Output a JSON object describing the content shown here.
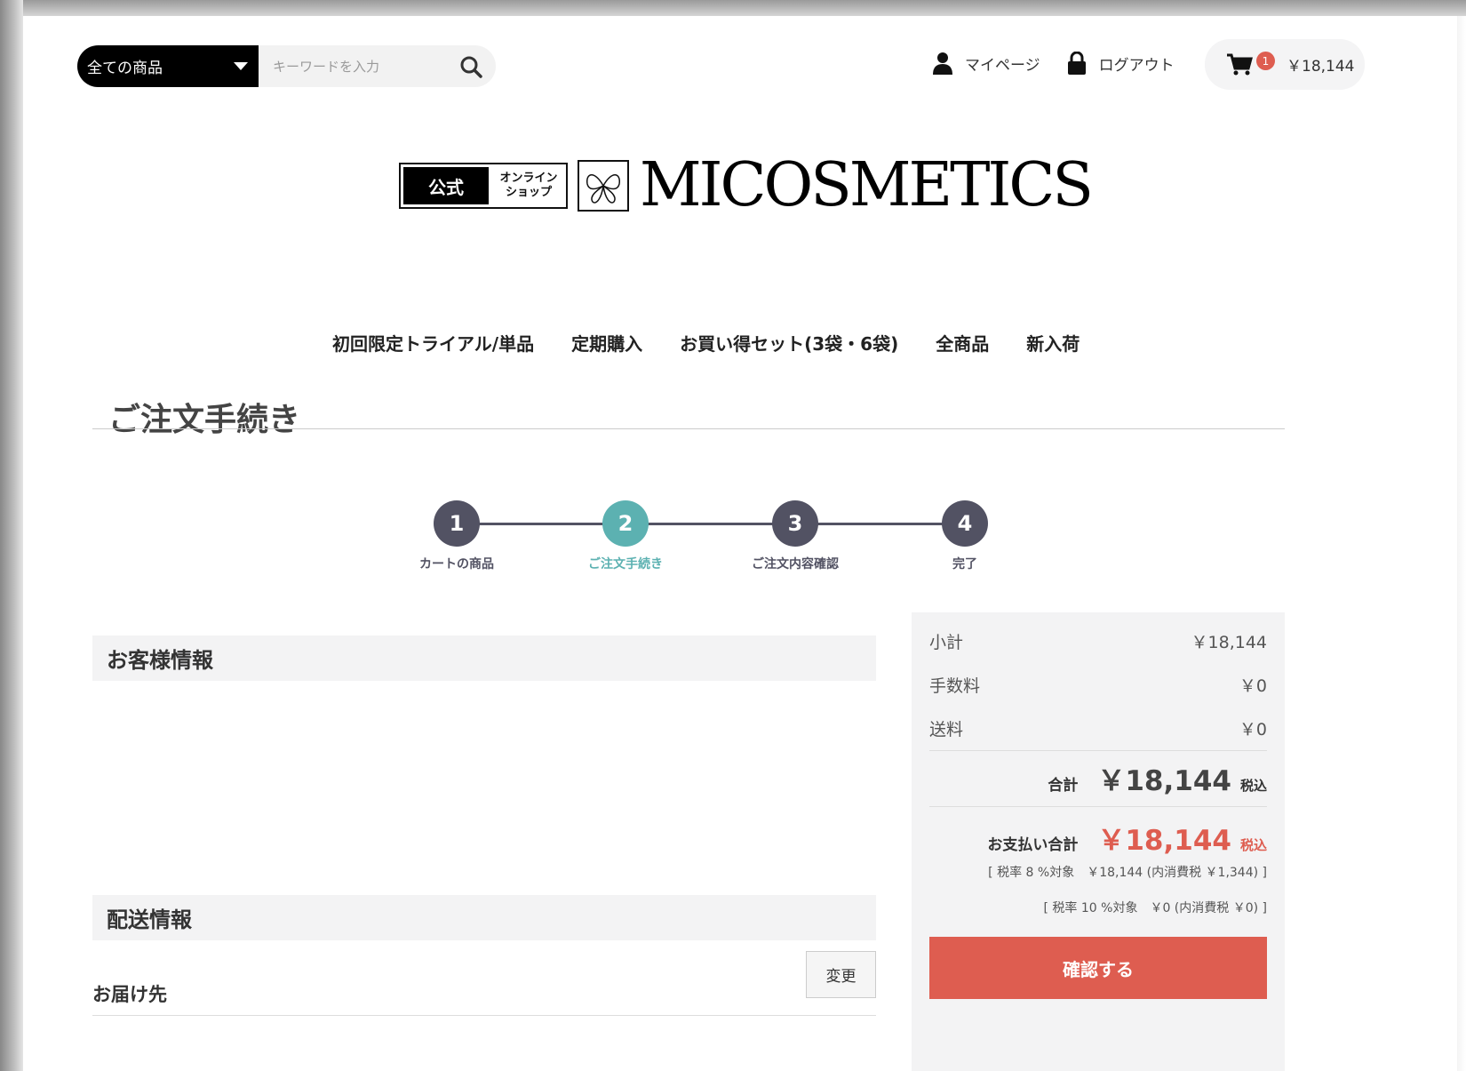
{
  "header": {
    "category_label": "全ての商品",
    "search_placeholder": "キーワードを入力",
    "mypage_label": "マイページ",
    "logout_label": "ログアウト",
    "cart_count": "1",
    "cart_total": "￥18,144"
  },
  "logo": {
    "official": "公式",
    "online_line1": "オンライン",
    "online_line2": "ショップ",
    "brand": "MICOSMETICS"
  },
  "nav": {
    "items": [
      "初回限定トライアル/単品",
      "定期購入",
      "お買い得セット(3袋・6袋)",
      "全商品",
      "新入荷"
    ]
  },
  "page_title": "ご注文手続き",
  "steps": [
    {
      "num": "1",
      "label": "カートの商品"
    },
    {
      "num": "2",
      "label": "ご注文手続き"
    },
    {
      "num": "3",
      "label": "ご注文内容確認"
    },
    {
      "num": "4",
      "label": "完了"
    }
  ],
  "active_step": 2,
  "sections": {
    "customer": "お客様情報",
    "delivery": "配送情報",
    "deliver_to": "お届け先",
    "change": "変更"
  },
  "summary": {
    "subtotal_label": "小計",
    "subtotal": "￥18,144",
    "fee_label": "手数料",
    "fee": "￥0",
    "shipping_label": "送料",
    "shipping": "￥0",
    "total_label": "合計",
    "total": "￥18,144",
    "tax_incl": "税込",
    "payment_label": "お支払い合計",
    "payment": "￥18,144",
    "tax8": "[ 税率 8 %対象　￥18,144 (内消費税 ￥1,344) ]",
    "tax10": "[ 税率 10 %対象　￥0 (内消費税 ￥0) ]",
    "confirm": "確認する"
  },
  "colors": {
    "accent": "#5cb1b1",
    "step_dark": "#525263",
    "red": "#de5d50"
  }
}
